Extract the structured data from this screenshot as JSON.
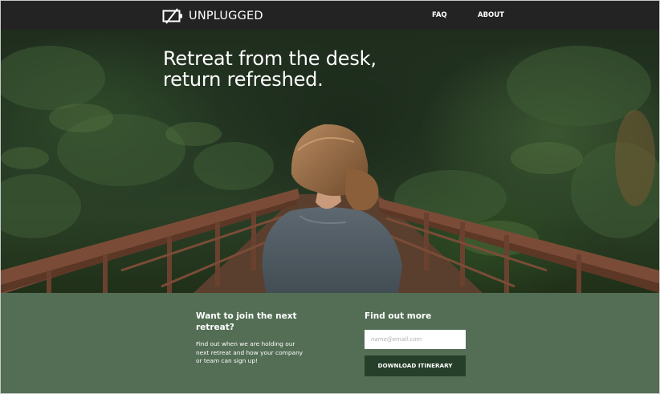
{
  "brand": {
    "name": "UNPLUGGED",
    "icon": "battery-unplugged-icon"
  },
  "nav": {
    "items": [
      {
        "label": "FAQ"
      },
      {
        "label": "ABOUT"
      }
    ]
  },
  "hero": {
    "title_line1": "Retreat from the desk,",
    "title_line2": "return refreshed.",
    "image": "woman-on-forest-bridge-photo"
  },
  "cta": {
    "join_title": "Want to join the next retreat?",
    "join_text": "Find out when we are holding our next retreat and how your company or team can sign up!",
    "find_title": "Find out more",
    "email_placeholder": "name@email.com",
    "button_label": "DOWNLOAD ITINERARY"
  },
  "colors": {
    "nav_background": "#232323",
    "section_background": "#536e54",
    "button_background": "#263f2a",
    "text": "#ffffff"
  }
}
